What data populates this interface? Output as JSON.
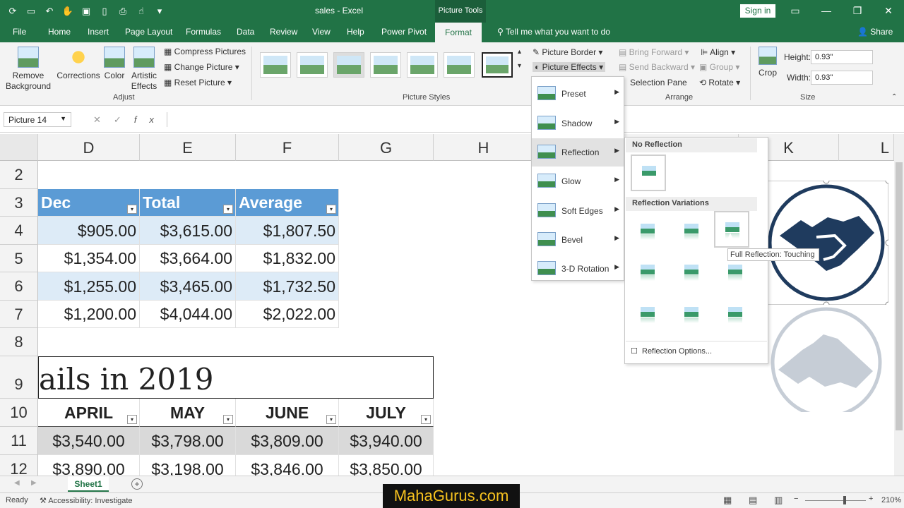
{
  "titlebar": {
    "title": "sales  -  Excel",
    "context_tab": "Picture Tools",
    "sign_in": "Sign in"
  },
  "tabs": [
    "File",
    "Home",
    "Insert",
    "Page Layout",
    "Formulas",
    "Data",
    "Review",
    "View",
    "Help",
    "Power Pivot"
  ],
  "active_tab": "Format",
  "tell_me": "Tell me what you want to do",
  "share": "Share",
  "ribbon": {
    "remove_background": "Remove Background",
    "corrections": "Corrections",
    "color": "Color",
    "artistic_effects": "Artistic Effects",
    "compress": "Compress Pictures",
    "change": "Change Picture",
    "reset": "Reset Picture",
    "adjust_label": "Adjust",
    "styles_label": "Picture Styles",
    "picture_border": "Picture Border",
    "picture_effects": "Picture Effects",
    "bring_forward": "Bring Forward",
    "send_backward": "Send Backward",
    "selection_pane": "Selection Pane",
    "align": "Align",
    "group": "Group",
    "rotate": "Rotate",
    "arrange_label": "Arrange",
    "crop": "Crop",
    "height_label": "Height:",
    "height_value": "0.93\"",
    "width_label": "Width:",
    "width_value": "0.93\"",
    "size_label": "Size"
  },
  "formula_bar": {
    "name_box": "Picture 14",
    "formula": ""
  },
  "columns": [
    "D",
    "E",
    "F",
    "G",
    "H",
    "K",
    "L"
  ],
  "rows": [
    "2",
    "3",
    "4",
    "5",
    "6",
    "7",
    "8",
    "9",
    "10",
    "11",
    "12"
  ],
  "table1": {
    "headers": [
      "Dec",
      "Total",
      "Average"
    ],
    "rows": [
      [
        "$905.00",
        "$3,615.00",
        "$1,807.50"
      ],
      [
        "$1,354.00",
        "$3,664.00",
        "$1,832.00"
      ],
      [
        "$1,255.00",
        "$3,465.00",
        "$1,732.50"
      ],
      [
        "$1,200.00",
        "$4,044.00",
        "$2,022.00"
      ]
    ]
  },
  "title_cell": "ails in 2019",
  "table2": {
    "headers": [
      "APRIL",
      "MAY",
      "JUNE",
      "JULY"
    ],
    "rows": [
      [
        "$3,540.00",
        "$3,798.00",
        "$3,809.00",
        "$3,940.00"
      ],
      [
        "$3,890.00",
        "$3,198.00",
        "$3,846.00",
        "$3,850.00"
      ]
    ]
  },
  "effects_menu": [
    "Preset",
    "Shadow",
    "Reflection",
    "Glow",
    "Soft Edges",
    "Bevel",
    "3-D Rotation"
  ],
  "reflection_menu": {
    "no_reflection": "No Reflection",
    "variations": "Reflection Variations",
    "options": "Reflection Options...",
    "tooltip": "Full Reflection: Touching"
  },
  "sheet_tab": "Sheet1",
  "status": {
    "ready": "Ready",
    "accessibility": "Accessibility: Investigate",
    "zoom": "210%"
  },
  "watermark": "MahaGurus.com"
}
